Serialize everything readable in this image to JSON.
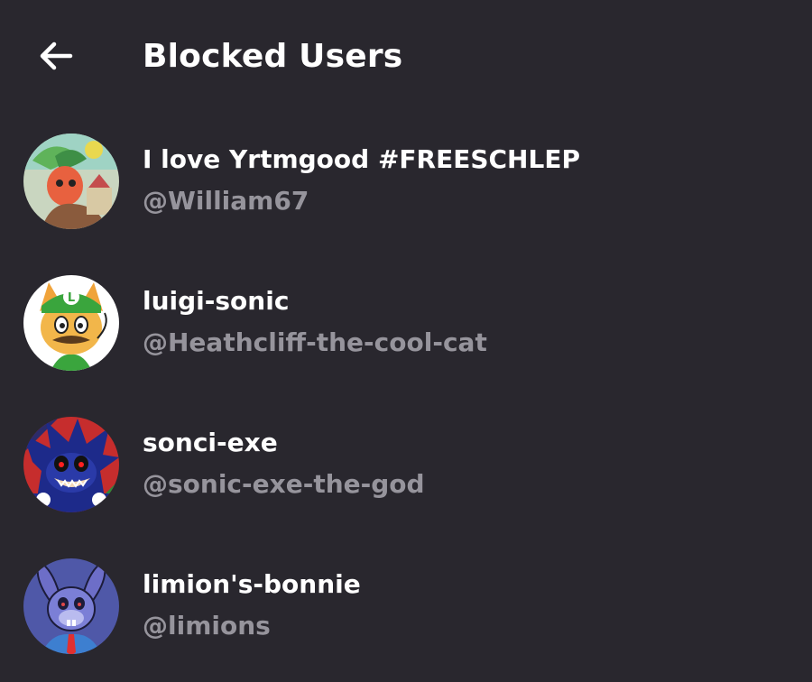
{
  "header": {
    "title": "Blocked Users",
    "back_icon": "arrow-left-icon"
  },
  "users": [
    {
      "display_name": "I love Yrtmgood #FREESCHLEP",
      "username": "@William67"
    },
    {
      "display_name": "luigi-sonic",
      "username": "@Heathcliff-the-cool-cat"
    },
    {
      "display_name": "sonci-exe",
      "username": "@sonic-exe-the-god"
    },
    {
      "display_name": "limion's-bonnie",
      "username": "@limions"
    }
  ],
  "colors": {
    "background": "#29272e",
    "primary_text": "#ffffff",
    "secondary_text": "#96949c"
  }
}
